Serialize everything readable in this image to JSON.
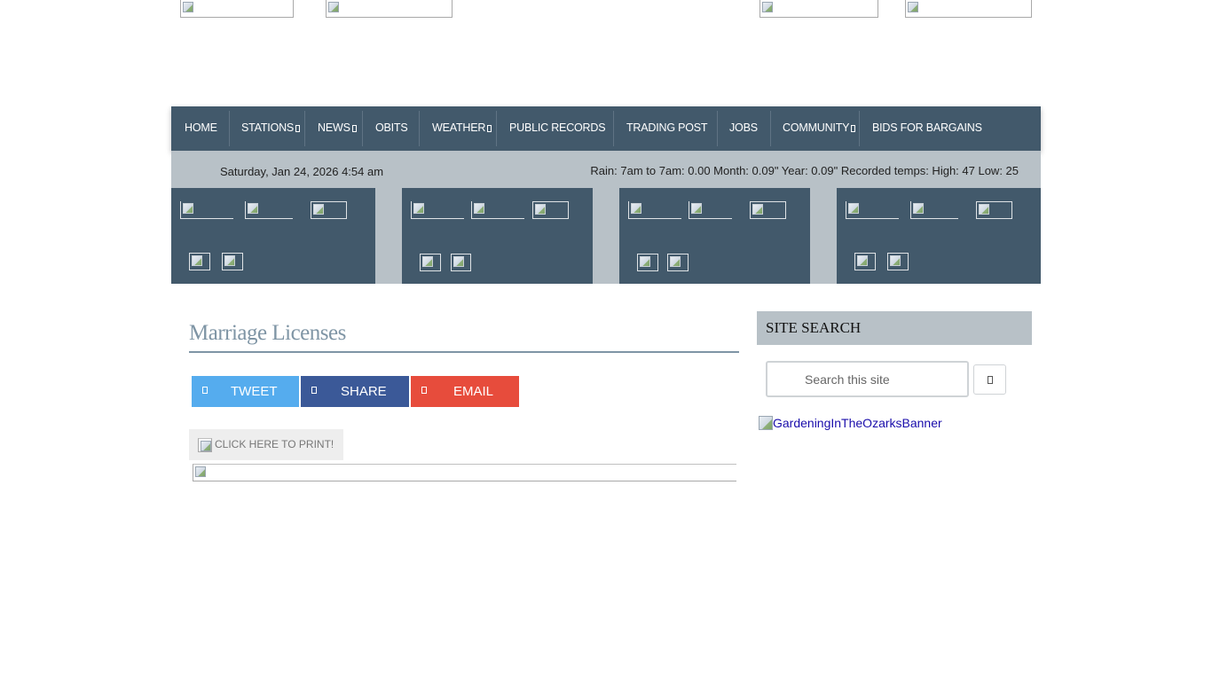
{
  "header": {
    "logos": [
      "logo-image-1",
      "logo-image-2",
      "logo-image-3",
      "logo-image-4"
    ]
  },
  "nav": {
    "items": [
      {
        "label": "HOME",
        "dropdown": false
      },
      {
        "label": "STATIONS",
        "dropdown": true
      },
      {
        "label": "NEWS",
        "dropdown": true
      },
      {
        "label": "OBITS",
        "dropdown": false
      },
      {
        "label": "WEATHER",
        "dropdown": true
      },
      {
        "label": "PUBLIC RECORDS",
        "dropdown": false
      },
      {
        "label": "TRADING POST",
        "dropdown": false
      },
      {
        "label": "JOBS",
        "dropdown": false
      },
      {
        "label": "COMMUNITY",
        "dropdown": true
      },
      {
        "label": "BIDS FOR BARGAINS",
        "dropdown": false
      }
    ]
  },
  "infobar": {
    "date": "Saturday, Jan 24, 2026 4:54 am",
    "weather": "Rain: 7am to 7am: 0.00  Month: 0.09\"  Year: 0.09\" Recorded temps:  High: 47  Low: 25"
  },
  "article": {
    "title": "Marriage Licenses",
    "share": {
      "tweet": "TWEET",
      "share": "SHARE",
      "email": "EMAIL"
    },
    "print_label": "CLICK HERE TO PRINT!"
  },
  "sidebar": {
    "search_heading": "SITE SEARCH",
    "search_placeholder": "Search this site",
    "banner_alt": "GardeningInTheOzarksBanner"
  },
  "colors": {
    "nav_bg": "#42596b",
    "infobar_bg": "#b8c1c7",
    "tweet": "#55acee",
    "share": "#3b5998",
    "email": "#e74c3c",
    "title": "#7f95a5"
  }
}
